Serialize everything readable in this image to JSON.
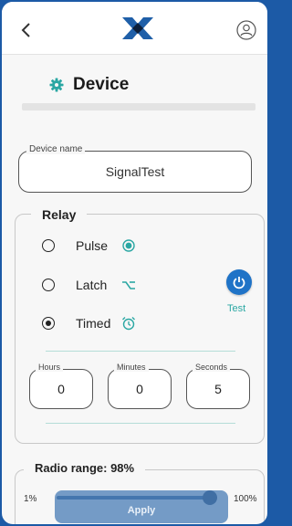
{
  "header": {
    "back_icon": "chevron-left-icon",
    "logo_icon": "brand-x-logo",
    "profile_icon": "user-circle-icon"
  },
  "section": {
    "title": "Device",
    "icon": "gear-icon"
  },
  "device_name": {
    "label": "Device name",
    "value": "SignalTest"
  },
  "relay": {
    "title": "Relay",
    "modes": [
      {
        "label": "Pulse",
        "selected": false,
        "icon": "pulse-toggle-icon"
      },
      {
        "label": "Latch",
        "selected": false,
        "icon": "latch-switch-icon"
      },
      {
        "label": "Timed",
        "selected": true,
        "icon": "alarm-clock-icon"
      }
    ],
    "test_label": "Test",
    "test_icon": "power-icon",
    "hours": {
      "label": "Hours",
      "value": "0"
    },
    "minutes": {
      "label": "Minutes",
      "value": "0"
    },
    "seconds": {
      "label": "Seconds",
      "value": "5"
    }
  },
  "radio_range": {
    "title": "Radio range: 98%",
    "min_label": "1%",
    "max_label": "100%",
    "value_percent": 98,
    "apply_label": "Apply"
  },
  "colors": {
    "accent_teal": "#2aa7a3",
    "primary_blue": "#1f73c7",
    "frame_blue": "#1c5aa6",
    "slider_dark": "#0d2e5c"
  }
}
